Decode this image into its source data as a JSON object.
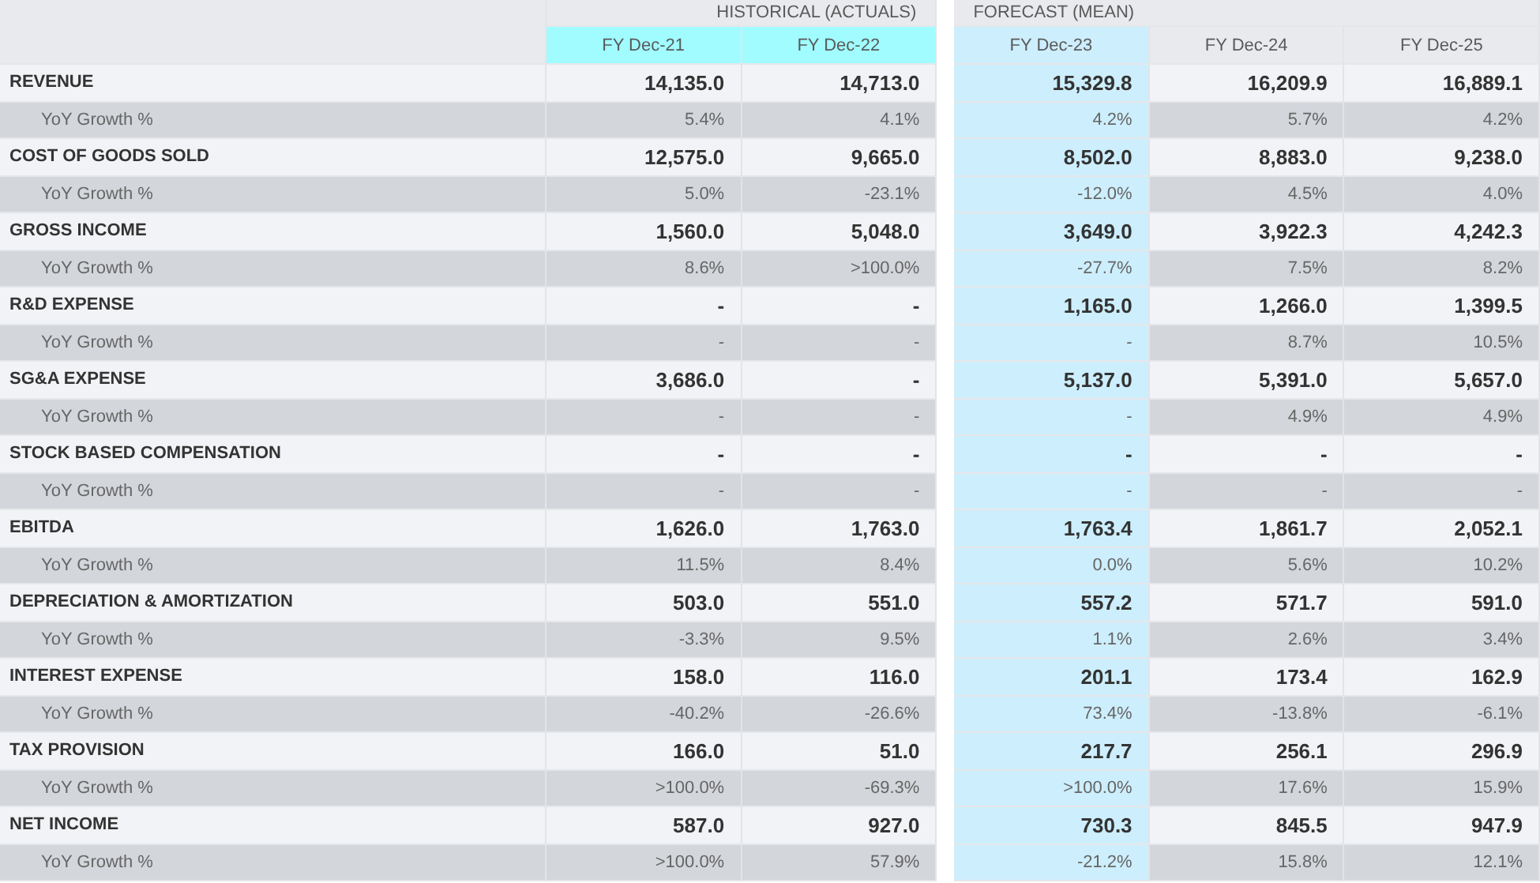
{
  "groups": [
    {
      "title": "HISTORICAL (ACTUALS)",
      "columns": [
        {
          "label": "FY Dec-21",
          "kind": "actual"
        },
        {
          "label": "FY Dec-22",
          "kind": "actual"
        }
      ]
    },
    {
      "title": "FORECAST (MEAN)",
      "columns": [
        {
          "label": "FY Dec-23",
          "kind": "current"
        },
        {
          "label": "FY Dec-24",
          "kind": "forecast"
        },
        {
          "label": "FY Dec-25",
          "kind": "forecast"
        }
      ]
    }
  ],
  "rows": [
    {
      "kind": "metric",
      "label": "REVENUE",
      "values": [
        "14,135.0",
        "14,713.0",
        "15,329.8",
        "16,209.9",
        "16,889.1"
      ]
    },
    {
      "kind": "growth",
      "label": "YoY Growth %",
      "values": [
        "5.4%",
        "4.1%",
        "4.2%",
        "5.7%",
        "4.2%"
      ]
    },
    {
      "kind": "metric",
      "label": "COST OF GOODS SOLD",
      "values": [
        "12,575.0",
        "9,665.0",
        "8,502.0",
        "8,883.0",
        "9,238.0"
      ]
    },
    {
      "kind": "growth",
      "label": "YoY Growth %",
      "values": [
        "5.0%",
        "-23.1%",
        "-12.0%",
        "4.5%",
        "4.0%"
      ]
    },
    {
      "kind": "metric",
      "label": "GROSS INCOME",
      "values": [
        "1,560.0",
        "5,048.0",
        "3,649.0",
        "3,922.3",
        "4,242.3"
      ]
    },
    {
      "kind": "growth",
      "label": "YoY Growth %",
      "values": [
        "8.6%",
        ">100.0%",
        "-27.7%",
        "7.5%",
        "8.2%"
      ]
    },
    {
      "kind": "metric",
      "label": "R&D EXPENSE",
      "values": [
        "-",
        "-",
        "1,165.0",
        "1,266.0",
        "1,399.5"
      ]
    },
    {
      "kind": "growth",
      "label": "YoY Growth %",
      "values": [
        "-",
        "-",
        "-",
        "8.7%",
        "10.5%"
      ]
    },
    {
      "kind": "metric",
      "label": "SG&A EXPENSE",
      "values": [
        "3,686.0",
        "-",
        "5,137.0",
        "5,391.0",
        "5,657.0"
      ]
    },
    {
      "kind": "growth",
      "label": "YoY Growth %",
      "values": [
        "-",
        "-",
        "-",
        "4.9%",
        "4.9%"
      ]
    },
    {
      "kind": "metric",
      "label": "STOCK BASED COMPENSATION",
      "values": [
        "-",
        "-",
        "-",
        "-",
        "-"
      ]
    },
    {
      "kind": "growth",
      "label": "YoY Growth %",
      "values": [
        "-",
        "-",
        "-",
        "-",
        "-"
      ]
    },
    {
      "kind": "metric",
      "label": "EBITDA",
      "values": [
        "1,626.0",
        "1,763.0",
        "1,763.4",
        "1,861.7",
        "2,052.1"
      ]
    },
    {
      "kind": "growth",
      "label": "YoY Growth %",
      "values": [
        "11.5%",
        "8.4%",
        "0.0%",
        "5.6%",
        "10.2%"
      ]
    },
    {
      "kind": "metric",
      "label": "DEPRECIATION & AMORTIZATION",
      "values": [
        "503.0",
        "551.0",
        "557.2",
        "571.7",
        "591.0"
      ]
    },
    {
      "kind": "growth",
      "label": "YoY Growth %",
      "values": [
        "-3.3%",
        "9.5%",
        "1.1%",
        "2.6%",
        "3.4%"
      ]
    },
    {
      "kind": "metric",
      "label": "INTEREST EXPENSE",
      "values": [
        "158.0",
        "116.0",
        "201.1",
        "173.4",
        "162.9"
      ]
    },
    {
      "kind": "growth",
      "label": "YoY Growth %",
      "values": [
        "-40.2%",
        "-26.6%",
        "73.4%",
        "-13.8%",
        "-6.1%"
      ]
    },
    {
      "kind": "metric",
      "label": "TAX PROVISION",
      "values": [
        "166.0",
        "51.0",
        "217.7",
        "256.1",
        "296.9"
      ]
    },
    {
      "kind": "growth",
      "label": "YoY Growth %",
      "values": [
        ">100.0%",
        "-69.3%",
        ">100.0%",
        "17.6%",
        "15.9%"
      ]
    },
    {
      "kind": "metric",
      "label": "NET INCOME",
      "values": [
        "587.0",
        "927.0",
        "730.3",
        "845.5",
        "947.9"
      ]
    },
    {
      "kind": "growth",
      "label": "YoY Growth %",
      "values": [
        ">100.0%",
        "57.9%",
        "-21.2%",
        "15.8%",
        "12.1%"
      ]
    }
  ]
}
